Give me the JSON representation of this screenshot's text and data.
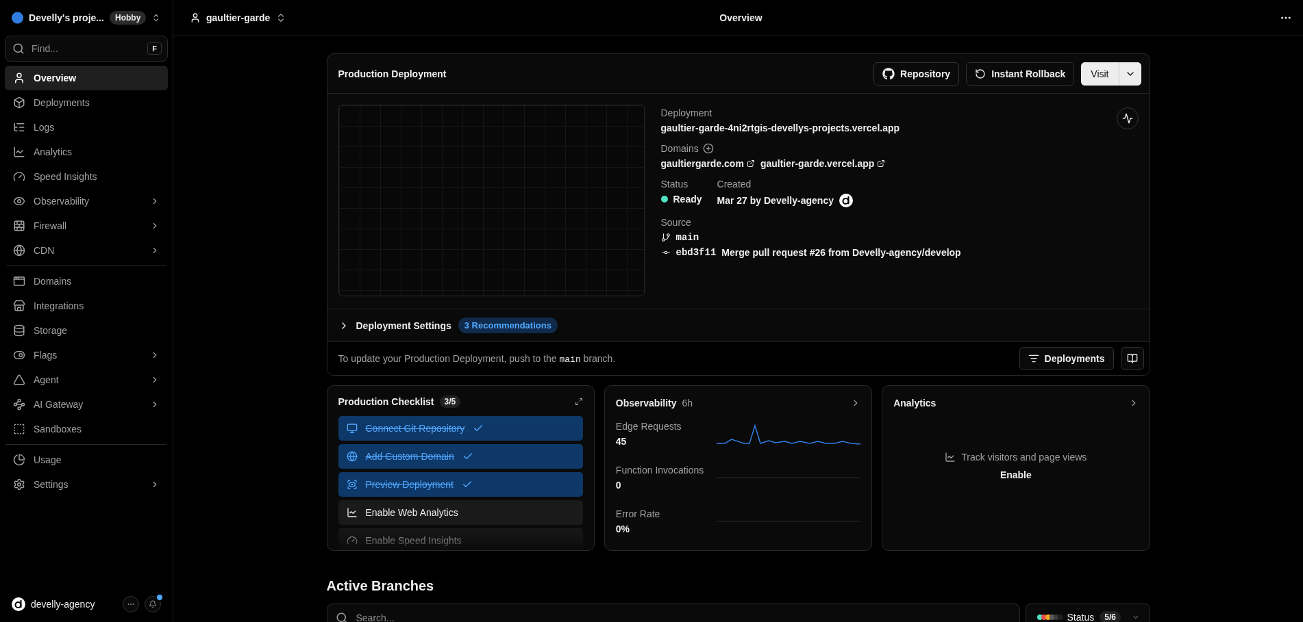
{
  "team": {
    "name": "Develly's proje...",
    "plan": "Hobby"
  },
  "project": {
    "name": "gaultier-garde"
  },
  "page_title": "Overview",
  "search": {
    "placeholder": "Find...",
    "shortcut": "F"
  },
  "nav_groups": [
    [
      {
        "label": "Overview",
        "selected": true,
        "expandable": false
      },
      {
        "label": "Deployments",
        "selected": false,
        "expandable": false
      },
      {
        "label": "Logs",
        "selected": false,
        "expandable": false
      },
      {
        "label": "Analytics",
        "selected": false,
        "expandable": false
      },
      {
        "label": "Speed Insights",
        "selected": false,
        "expandable": false
      },
      {
        "label": "Observability",
        "selected": false,
        "expandable": true
      },
      {
        "label": "Firewall",
        "selected": false,
        "expandable": true
      },
      {
        "label": "CDN",
        "selected": false,
        "expandable": true
      }
    ],
    [
      {
        "label": "Domains",
        "selected": false,
        "expandable": false
      },
      {
        "label": "Integrations",
        "selected": false,
        "expandable": false
      },
      {
        "label": "Storage",
        "selected": false,
        "expandable": false
      },
      {
        "label": "Flags",
        "selected": false,
        "expandable": true
      },
      {
        "label": "Agent",
        "selected": false,
        "expandable": true
      },
      {
        "label": "AI Gateway",
        "selected": false,
        "expandable": true
      },
      {
        "label": "Sandboxes",
        "selected": false,
        "expandable": false
      }
    ],
    [
      {
        "label": "Usage",
        "selected": false,
        "expandable": false
      },
      {
        "label": "Settings",
        "selected": false,
        "expandable": true
      }
    ]
  ],
  "user": {
    "name": "develly-agency",
    "has_notifications": true
  },
  "production": {
    "title": "Production Deployment",
    "buttons": {
      "repository": "Repository",
      "rollback": "Instant Rollback",
      "visit": "Visit"
    },
    "deployment_label": "Deployment",
    "deployment_url": "gaultier-garde-4ni2rtgis-devellys-projects.vercel.app",
    "domains_label": "Domains",
    "domains": [
      "gaultiergarde.com",
      "gaultier-garde.vercel.app"
    ],
    "status_label": "Status",
    "status": {
      "text": "Ready",
      "color": "#50e3c2"
    },
    "created_label": "Created",
    "created": "Mar 27 by Develly-agency",
    "source_label": "Source",
    "branch": "main",
    "commit": "ebd3f11",
    "commit_message": "Merge pull request #26 from Develly-agency/develop",
    "settings": {
      "label": "Deployment Settings",
      "expanded": false,
      "recommendations": "3 Recommendations"
    },
    "hint": {
      "before": "To update your Production Deployment, push to the",
      "code": "main",
      "after": "branch."
    },
    "deployments_button": "Deployments"
  },
  "checklist": {
    "title": "Production Checklist",
    "count": "3/5",
    "items": [
      {
        "label": "Connect Git Repository",
        "done": true
      },
      {
        "label": "Add Custom Domain",
        "done": true
      },
      {
        "label": "Preview Deployment",
        "done": true
      },
      {
        "label": "Enable Web Analytics",
        "done": false
      },
      {
        "label": "Enable Speed Insights",
        "done": false
      }
    ]
  },
  "observability": {
    "title": "Observability",
    "period": "6h",
    "metrics": [
      {
        "label": "Edge Requests",
        "value": "45"
      },
      {
        "label": "Function Invocations",
        "value": "0"
      },
      {
        "label": "Error Rate",
        "value": "0%"
      }
    ]
  },
  "analytics": {
    "title": "Analytics",
    "message": "Track visitors and page views",
    "action": "Enable"
  },
  "branches": {
    "title": "Active Branches",
    "search_placeholder": "Search...",
    "status_label": "Status",
    "status_count": "5/6",
    "status_dots": [
      {
        "color": "#50e3c2"
      },
      {
        "color": "#e5484d"
      },
      {
        "color": "#f5a623"
      },
      {
        "color": "#5a5a5a"
      },
      {
        "color": "#3a3a3a"
      },
      {
        "color": "#1f1f1f"
      }
    ]
  }
}
